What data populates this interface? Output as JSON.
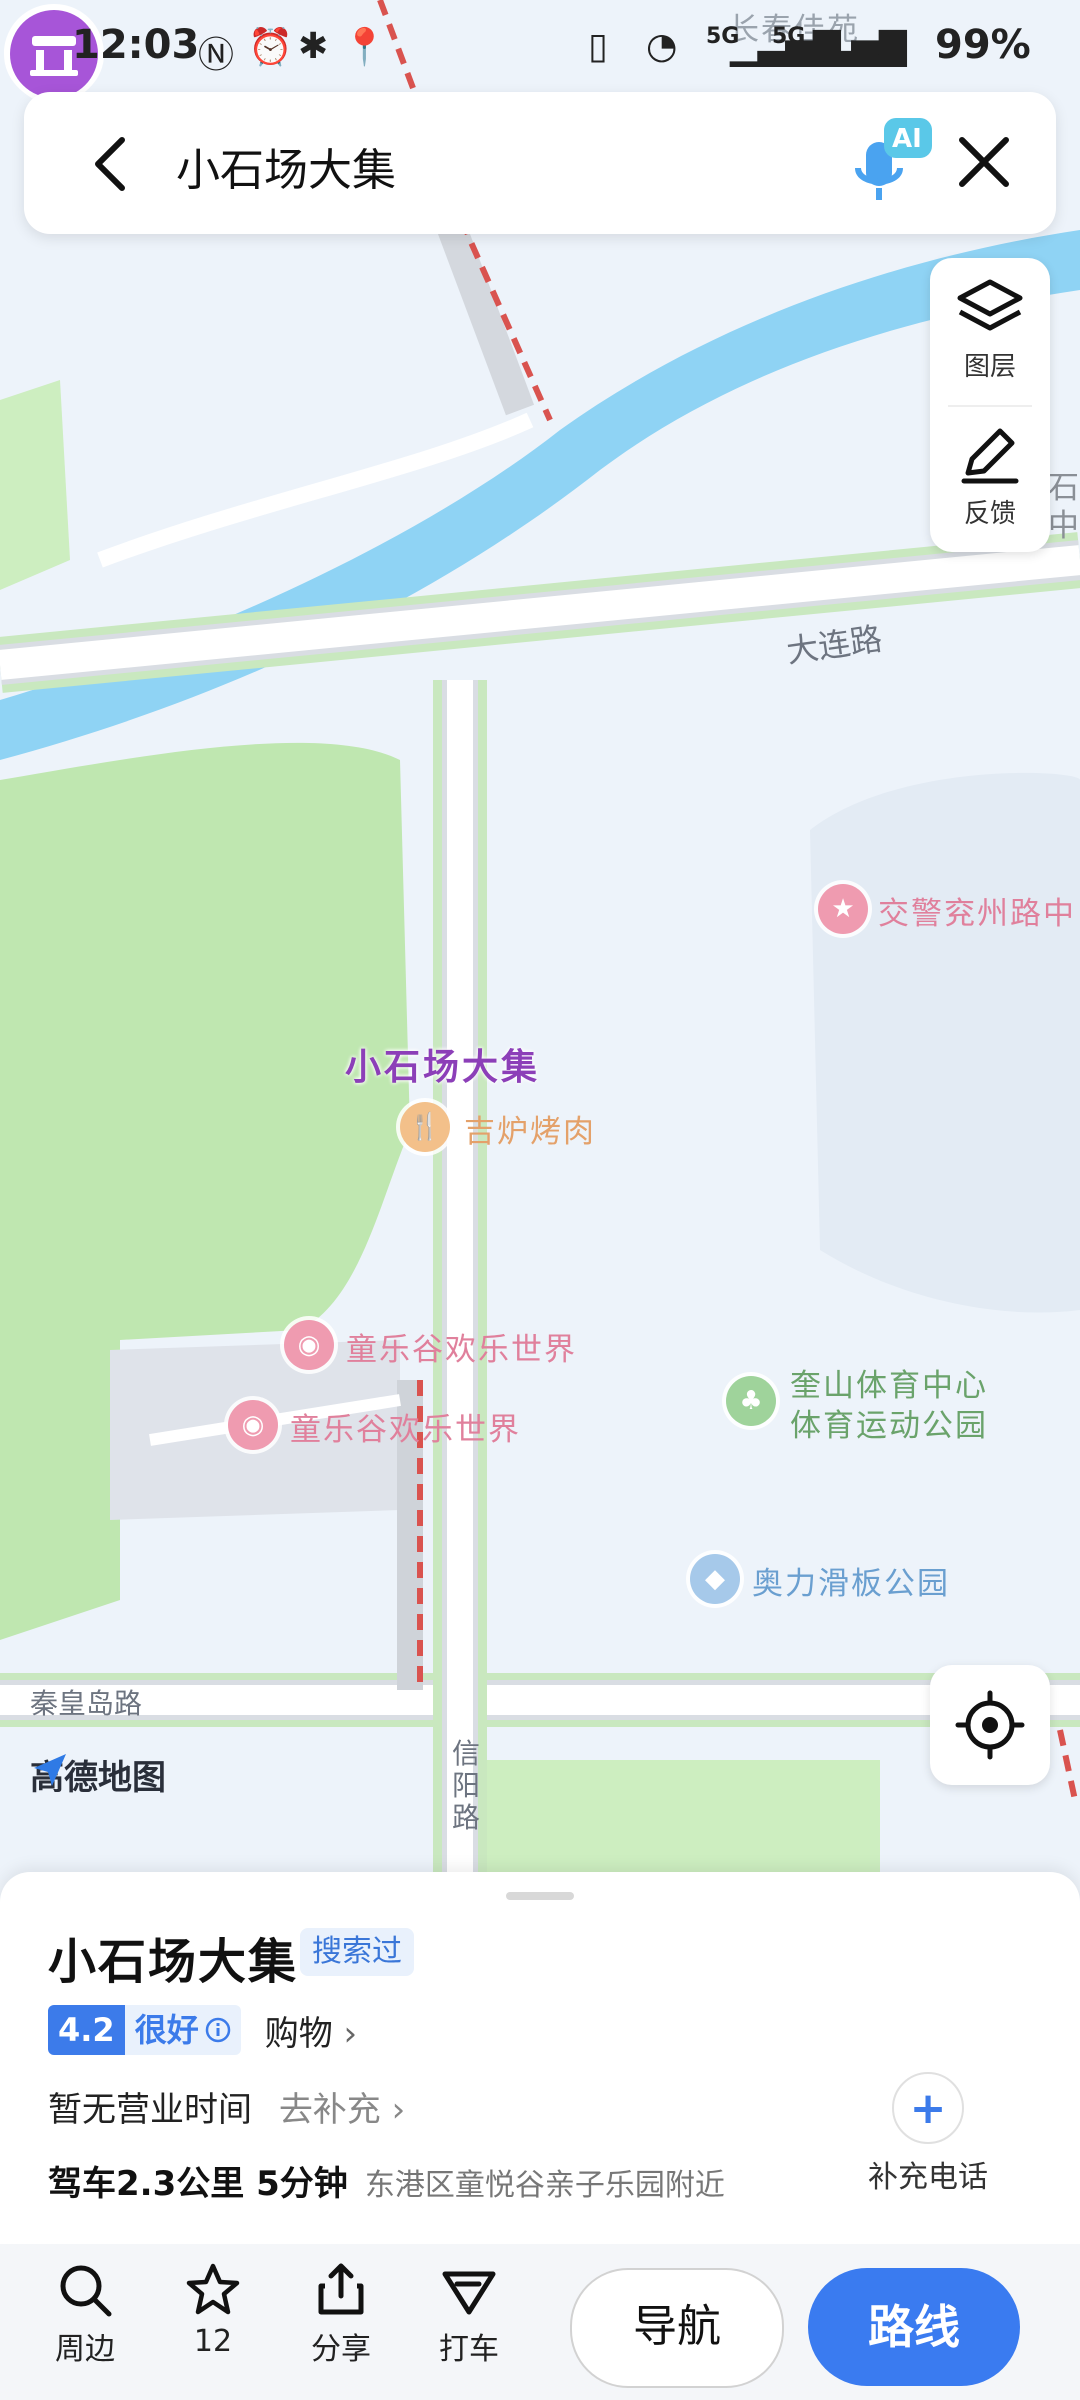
{
  "status_bar": {
    "time": "12:03",
    "battery": "99%",
    "signal1": "5G",
    "signal2": "5G"
  },
  "search": {
    "query": "小石场大集",
    "ai_badge": "AI"
  },
  "tools": {
    "layers": "图层",
    "feedback": "反馈"
  },
  "map": {
    "brand": "高德地图",
    "roads": {
      "dalian": "大连路",
      "qinhuangdao": "秦皇岛路",
      "xinyang": "信阳路"
    },
    "pois": {
      "changchun": "长春佳苑",
      "traffic_police": "交警兖州路中",
      "jilu": "吉炉烤肉",
      "tongle1": "童乐谷欢乐世界",
      "tongle2": "童乐谷欢乐世界",
      "kuishan_line1": "奎山体育中心",
      "kuishan_line2": "体育运动公园",
      "aoli": "奥力滑板公园",
      "shi_partial": "石",
      "zhong_partial": "中"
    },
    "marker_label": "小石场大集",
    "colors": {
      "water": "#8fd3f4",
      "green": "#bfe7b0",
      "road": "#ffffff",
      "marker": "#a755d8"
    }
  },
  "place": {
    "name": "小石场大集",
    "searched_tag": "搜索过",
    "rating": "4.2",
    "rating_text": "很好",
    "category": "购物",
    "hours": "暂无营业时间",
    "hours_add": "去补充",
    "drive_info": "驾车2.3公里 5分钟",
    "address": "东港区童悦谷亲子乐园附近",
    "add_phone": "补充电话"
  },
  "actions": {
    "nearby": "周边",
    "favorites_count": "12",
    "share": "分享",
    "taxi": "打车",
    "navigate": "导航",
    "route": "路线"
  }
}
